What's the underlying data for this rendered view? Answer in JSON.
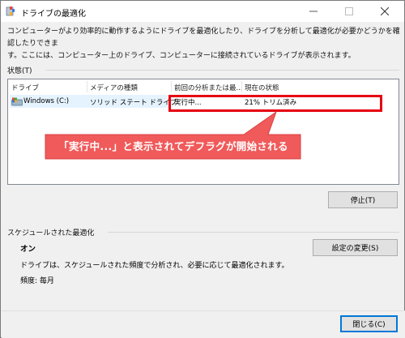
{
  "window": {
    "title": "ドライブの最適化"
  },
  "description": {
    "line1": "コンピューターがより効率的に動作するようにドライブを最適化したり、ドライブを分析して最適化が必要かどうかを確認したりできま",
    "line2": "す。ここには、コンピューター上のドライブ、コンピューターに接続されているドライブが表示されます。"
  },
  "status_section": {
    "label": "状態(T)"
  },
  "drive_table": {
    "columns": [
      "ドライブ",
      "メディアの種類",
      "前回の分析または最...",
      "現在の状態"
    ],
    "rows": [
      {
        "drive": "Windows (C:)",
        "media_type": "ソリッド ステート ドライブ",
        "last_run": "実行中...",
        "current_status": "21% トリム済み"
      }
    ]
  },
  "callout": {
    "text": "「実行中...」と表示されてデフラグが開始される",
    "color": "#f05a5a"
  },
  "buttons": {
    "stop": "停止(T)",
    "change_settings": "設定の変更(S)",
    "close": "閉じる(C)"
  },
  "schedule_section": {
    "label": "スケジュールされた最適化",
    "state": "オン",
    "description": "ドライブは、スケジュールされた頻度で分析され、必要に応じて最適化されます。",
    "frequency": "頻度: 毎月"
  },
  "colors": {
    "highlight_border": "#e60012",
    "accent": "#0078d7"
  }
}
